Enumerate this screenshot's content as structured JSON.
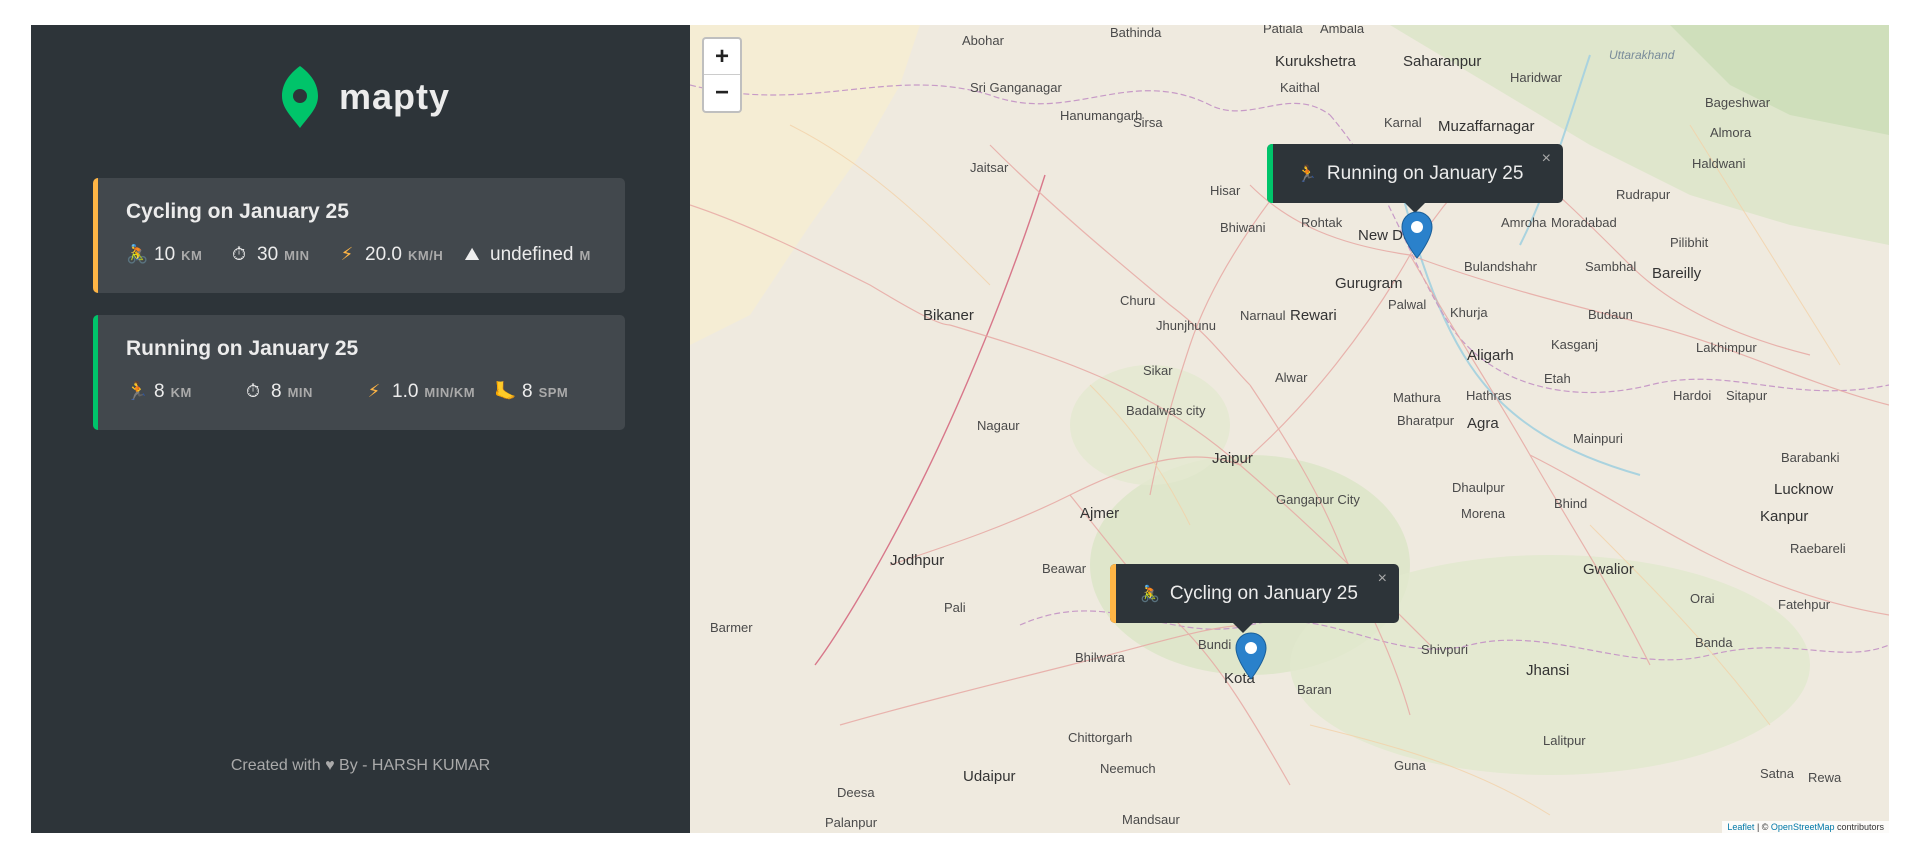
{
  "brand": {
    "name": "mapty"
  },
  "workouts": [
    {
      "type": "cycling",
      "title": "Cycling on January 25",
      "details": [
        {
          "icon": "🚴",
          "value": "10",
          "unit": "KM"
        },
        {
          "icon": "⏱",
          "value": "30",
          "unit": "MIN"
        },
        {
          "icon": "⚡",
          "value": "20.0",
          "unit": "KM/H"
        },
        {
          "icon": "⛰",
          "value": "undefined",
          "unit": "M"
        }
      ]
    },
    {
      "type": "running",
      "title": "Running on January 25",
      "details": [
        {
          "icon": "🏃",
          "value": "8",
          "unit": "KM"
        },
        {
          "icon": "⏱",
          "value": "8",
          "unit": "MIN"
        },
        {
          "icon": "⚡",
          "value": "1.0",
          "unit": "MIN/KM"
        },
        {
          "icon": "🦶",
          "value": "8",
          "unit": "SPM"
        }
      ]
    }
  ],
  "copyright": "Created with ♥ By - HARSH KUMAR",
  "map": {
    "zoom_in": "+",
    "zoom_out": "−",
    "popups": [
      {
        "type": "running",
        "icon": "🏃",
        "text": "Running on January 25",
        "close": "×"
      },
      {
        "type": "cycling",
        "icon": "🚴",
        "text": "Cycling on January 25",
        "close": "×"
      }
    ],
    "labels": [
      "Abohar",
      "Bathinda",
      "Patiala",
      "Ambala",
      "Kurukshetra",
      "Saharanpur",
      "Haridwar",
      "Uttarakhand",
      "Bageshwar",
      "Almora",
      "Sri Ganganagar",
      "Hanumangarh",
      "Sirsa",
      "Kaithal",
      "Karnal",
      "Muzaffarnagar",
      "Haldwani",
      "Rudrapur",
      "Jaitsar",
      "Hisar",
      "Rohtak",
      "New Delhi",
      "Amroha",
      "Moradabad",
      "Pilibhit",
      "Bhiwani",
      "Bulandshahr",
      "Sambhal",
      "Bareilly",
      "Gurugram",
      "Palwal",
      "Khurja",
      "Budaun",
      "Bikaner",
      "Churu",
      "Jhunjhunu",
      "Narnaul",
      "Rewari",
      "Aligarh",
      "Kasganj",
      "Lakhimpur",
      "Sikar",
      "Alwar",
      "Etah",
      "Mathura",
      "Hathras",
      "Hardoi",
      "Sitapur",
      "Nagaur",
      "Badalwas city",
      "Bharatpur",
      "Agra",
      "Mainpuri",
      "Jaipur",
      "Barabanki",
      "Lucknow",
      "Dhaulpur",
      "Ajmer",
      "Gangapur City",
      "Bhind",
      "Morena",
      "Kanpur",
      "Raebareli",
      "Jodhpur",
      "Beawar",
      "Gwalior",
      "Orai",
      "Fatehpur",
      "Pali",
      "Barmer",
      "Bhilwara",
      "Bundi",
      "Kota",
      "Baran",
      "Shivpuri",
      "Banda",
      "Jhansi",
      "Chittorgarh",
      "Lalitpur",
      "Udaipur",
      "Neemuch",
      "Guna",
      "Satna",
      "Rewa",
      "Deesa",
      "Palanpur",
      "Mandsaur"
    ],
    "attribution": {
      "leaflet": "Leaflet",
      "sep": " | © ",
      "osm": "OpenStreetMap",
      "suffix": " contributors"
    }
  },
  "colors": {
    "cycling": "#ffb545",
    "running": "#00c46a",
    "sidebar": "#2d3439",
    "card": "#42484d",
    "marker": "#2a81cb"
  }
}
